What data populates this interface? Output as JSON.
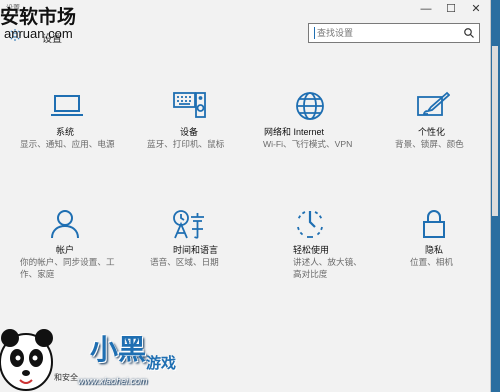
{
  "window": {
    "title": "设置",
    "minimize_glyph": "—",
    "maximize_glyph": "☐",
    "close_glyph": "✕"
  },
  "header": {
    "title": "设置"
  },
  "search": {
    "placeholder": "查找设置",
    "value": ""
  },
  "tiles": [
    {
      "title": "系统",
      "desc": "显示、通知、应用、电源",
      "icon": "laptop-icon"
    },
    {
      "title": "设备",
      "desc": "蓝牙、打印机、鼠标",
      "icon": "keyboard-speaker-icon"
    },
    {
      "title": "网络和 Internet",
      "desc": "Wi-Fi、飞行模式、VPN",
      "icon": "globe-icon"
    },
    {
      "title": "个性化",
      "desc": "背景、锁屏、颜色",
      "icon": "paintbrush-icon"
    },
    {
      "title": "帐户",
      "desc": "你的帐户、同步设置、工作、家庭",
      "icon": "person-icon"
    },
    {
      "title": "时间和语言",
      "desc": "语音、区域、日期",
      "icon": "time-language-icon"
    },
    {
      "title": "轻松使用",
      "desc": "讲述人、放大镜、高对比度",
      "icon": "ease-of-access-icon"
    },
    {
      "title": "隐私",
      "desc": "位置、相机",
      "icon": "lock-icon"
    }
  ],
  "partial_bottom_label": "和安全",
  "watermarks": {
    "top_brand": "安软市场",
    "top_url": "anruan.com",
    "bottom_brand": "小黑",
    "bottom_game": "游戏",
    "bottom_url": "www.xiaohei.com"
  },
  "colors": {
    "accent": "#1f6fb2",
    "window_bg": "#f2f2f2",
    "desktop_bg": "#2b6ea0"
  }
}
